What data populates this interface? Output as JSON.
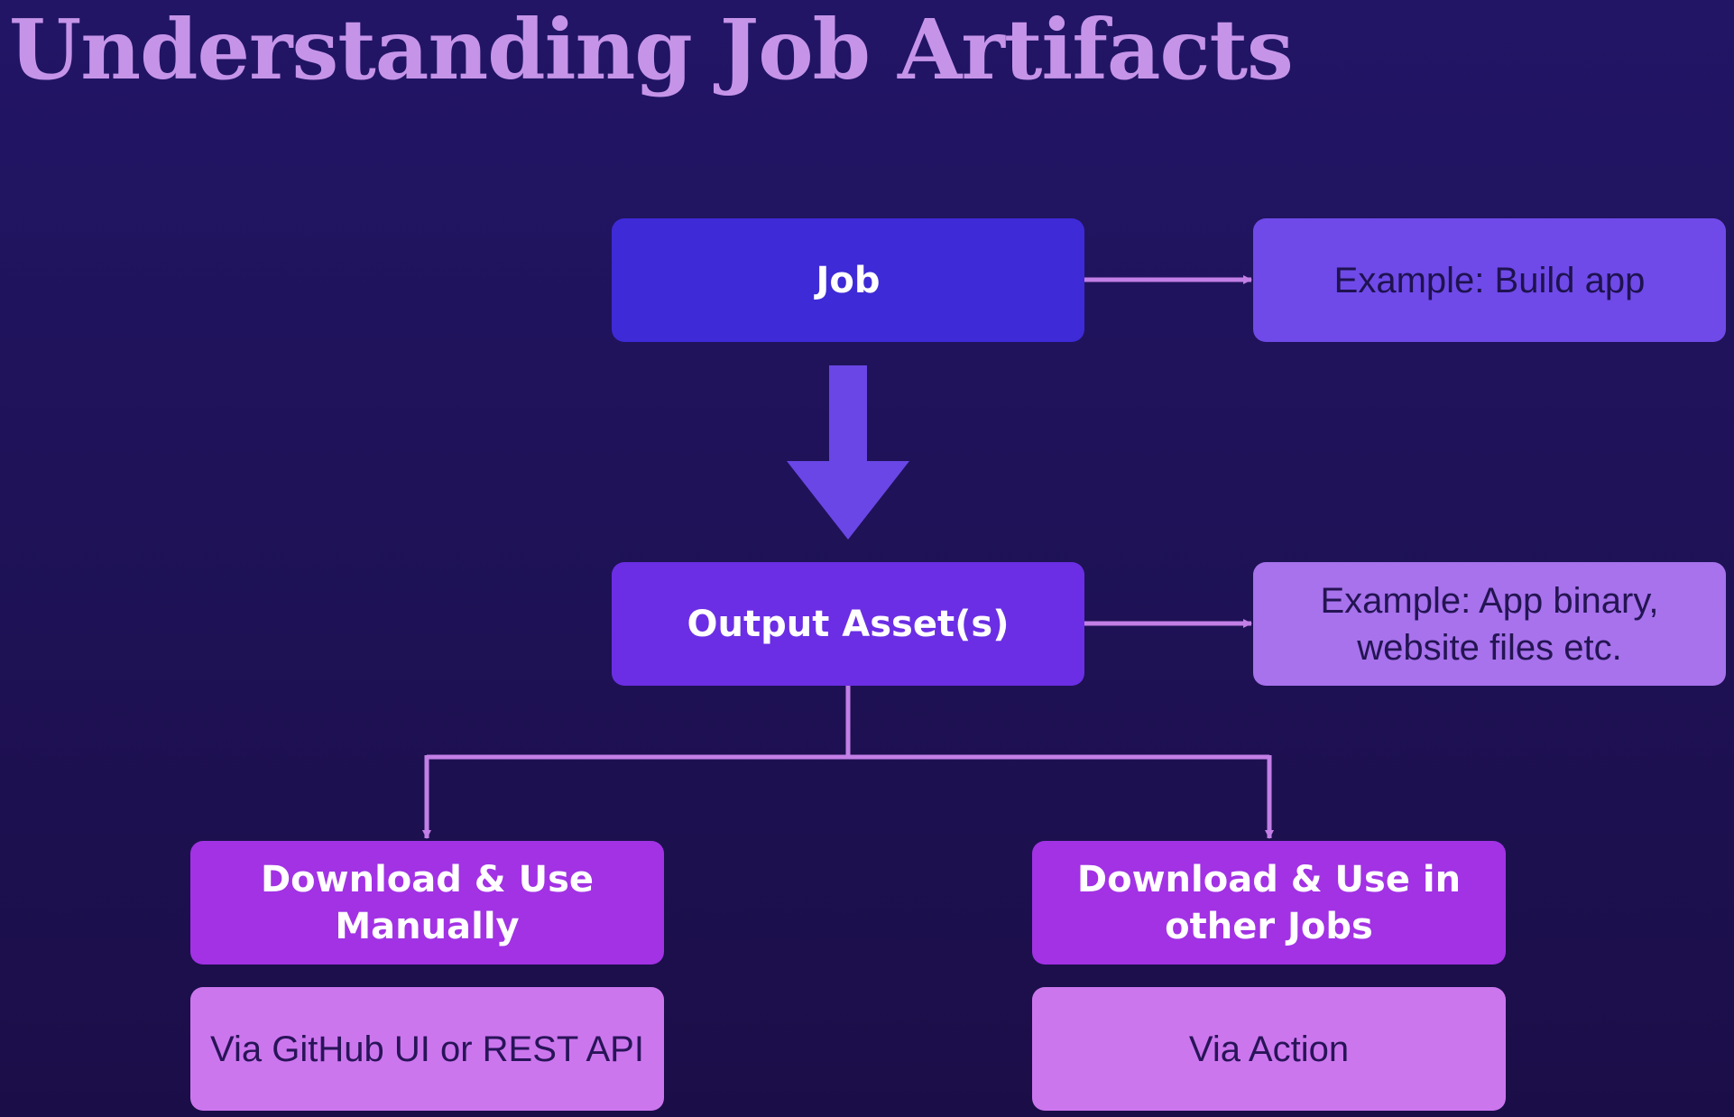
{
  "title": "Understanding Job Artifacts",
  "nodes": {
    "job": "Job",
    "job_example": "Example: Build app",
    "output": "Output Asset(s)",
    "output_example": "Example: App binary, website files etc.",
    "download_manual": "Download & Use Manually",
    "download_manual_detail": "Via GitHub UI or REST API",
    "download_jobs": "Download & Use in other Jobs",
    "download_jobs_detail": "Via Action"
  },
  "colors": {
    "background": "#1f1258",
    "title": "#c594e8",
    "job_box": "#3e2ad6",
    "output_box": "#6b2ee4",
    "example_box_1": "#6f4ae8",
    "example_box_2": "#a772ec",
    "download_box": "#a232e4",
    "detail_box": "#cc76ee",
    "big_arrow": "#6a46e6",
    "connector": "#c27fe6"
  }
}
